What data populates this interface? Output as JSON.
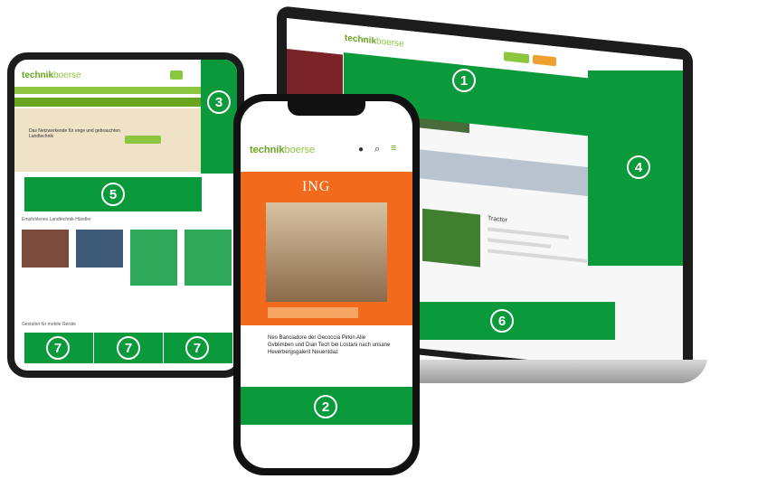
{
  "phone": {
    "logo": {
      "main": "technik",
      "accent": "boerse"
    },
    "ad_brand": "ING",
    "article_text": "Neo Banciadore der Gecoccia Pirkin Alle Gvblimben und Dian Tech bei Lostani nach unsane Heverbergsgalerit Neuentdaz"
  },
  "tablet": {
    "logo": {
      "main": "technik",
      "accent": "boerse"
    },
    "banner_text": "Das Netzwerkende für enge und gebrauchten Landtechnik",
    "section_title": "Empfohlenes Landtechnik-Händler",
    "bottom_title": "Gestaltet für mobile Geräte"
  },
  "laptop": {
    "logo": {
      "main": "technik",
      "accent": "boerse"
    },
    "listing_title": "Tractor"
  },
  "markers": {
    "m1": "1",
    "m2": "2",
    "m3": "3",
    "m4": "4",
    "m5": "5",
    "m6": "6",
    "m7a": "7",
    "m7b": "7",
    "m7c": "7"
  },
  "colors": {
    "highlight_green": "#0a9a3c",
    "brand_lime": "#8cc63f",
    "ad_orange": "#f26a1b",
    "device_black": "#1c1c1c"
  }
}
